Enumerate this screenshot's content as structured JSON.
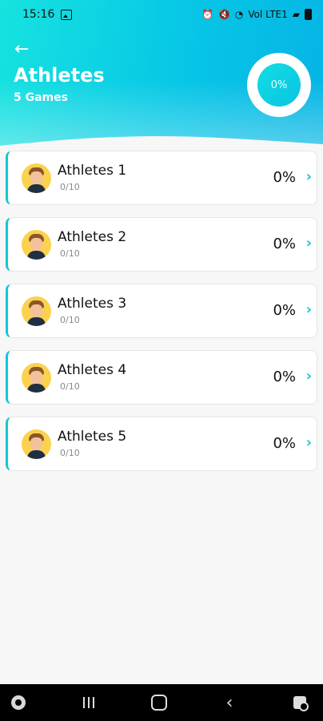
{
  "status_bar": {
    "time": "15:16",
    "right_status": "Vol LTE1"
  },
  "header": {
    "title": "Athletes",
    "subtitle": "5 Games",
    "overall_progress": "0%"
  },
  "athletes": [
    {
      "name": "Athletes 1",
      "count": "0/10",
      "percent": "0%"
    },
    {
      "name": "Athletes 2",
      "count": "0/10",
      "percent": "0%"
    },
    {
      "name": "Athletes 3",
      "count": "0/10",
      "percent": "0%"
    },
    {
      "name": "Athletes 4",
      "count": "0/10",
      "percent": "0%"
    },
    {
      "name": "Athletes 5",
      "count": "0/10",
      "percent": "0%"
    }
  ],
  "icons": {
    "back": "arrow-left",
    "chevron": "chevron-right",
    "nav": [
      "gamepad",
      "recent-apps",
      "home",
      "back",
      "assistant"
    ]
  },
  "colors": {
    "accent": "#13c7d4",
    "header_start": "#16e3e0",
    "header_end": "#05b4e5"
  }
}
